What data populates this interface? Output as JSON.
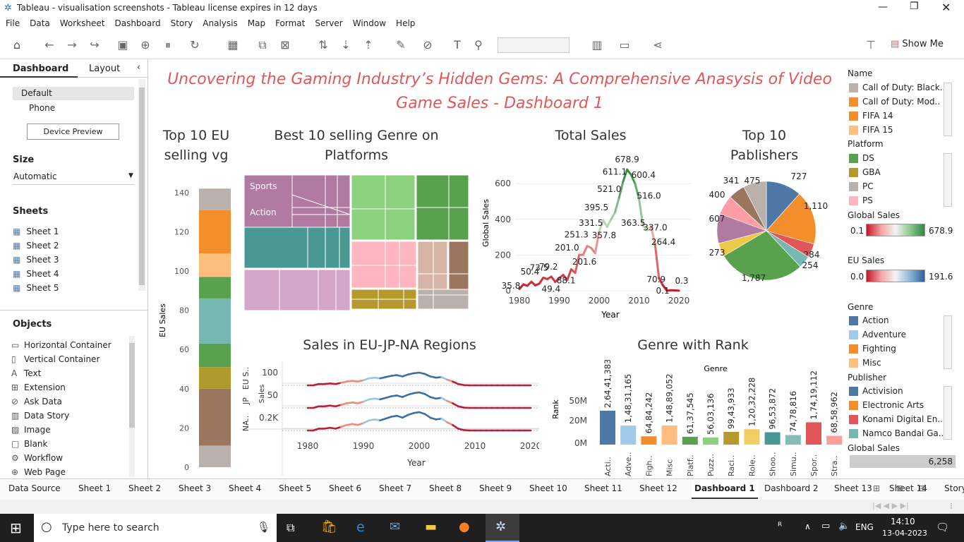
{
  "window": {
    "title": "Tableau - visualisation screenshots - Tableau license expires in 12 days"
  },
  "menu": [
    "File",
    "Data",
    "Worksheet",
    "Dashboard",
    "Story",
    "Analysis",
    "Map",
    "Format",
    "Server",
    "Window",
    "Help"
  ],
  "toolbar": {
    "show_me": "Show Me"
  },
  "left": {
    "tab_dashboard": "Dashboard",
    "tab_layout": "Layout",
    "devices": [
      "Default",
      "Phone"
    ],
    "device_preview": "Device Preview",
    "size_h": "Size",
    "size_val": "Automatic",
    "sheets_h": "Sheets",
    "sheets": [
      "Sheet 1",
      "Sheet 2",
      "Sheet 3",
      "Sheet 4",
      "Sheet 5"
    ],
    "objects_h": "Objects",
    "objects": [
      "Horizontal Container",
      "Vertical Container",
      "Text",
      "Extension",
      "Ask Data",
      "Data Story",
      "Image",
      "Blank",
      "Workflow",
      "Web Page"
    ]
  },
  "dashboard": {
    "title": "Uncovering the Gaming Industry’s Hidden Gems: A Comprehensive Anasysis of Video Game Sales - Dashboard  1",
    "eu_title": "Top 10 EU selling vg",
    "eu_ylabel": "EU Sales",
    "eu_ticks": [
      "140",
      "120",
      "100",
      "80",
      "60",
      "40",
      "20",
      "0"
    ],
    "tm_title": "Best 10 selling Genre on Platforms",
    "tm_labels": [
      "Sports",
      "Action"
    ],
    "ts_title": "Total Sales",
    "ts_ylabel": "Global Sales",
    "ts_xlabel": "Year",
    "pie_title": "Top 10 Pablishers",
    "reg_title": "Sales in EU-JP-NA Regions",
    "reg_xlabel": "Year",
    "reg_sales": "Sales",
    "reg_rows": [
      "EU S..",
      "JP",
      "NA.."
    ],
    "reg_ticks": [
      "100",
      "50",
      "0.2K"
    ],
    "rank_title": "Genre with Rank",
    "rank_header": "Genre",
    "rank_ylabel": "Rank"
  },
  "chart_data": [
    {
      "type": "bar",
      "title": "Top 10 EU selling vg",
      "ylabel": "EU Sales",
      "ylim": [
        0,
        145
      ],
      "stacked": true,
      "colors": [
        "#bab0ac",
        "#9c755f",
        "#b09a2c",
        "#59a14f",
        "#76b7b2",
        "#59a14f",
        "#ffbe7d",
        "#f28e2b",
        "#bab0ac"
      ],
      "values": [
        11,
        29,
        11,
        12,
        23,
        11,
        12,
        22,
        11
      ]
    },
    {
      "type": "line",
      "title": "Total Sales",
      "xlabel": "Year",
      "ylabel": "Global Sales",
      "ylim": [
        0,
        700
      ],
      "x": [
        1980,
        1983,
        1985,
        1987,
        1989,
        1991,
        1993,
        1995,
        1997,
        2000,
        2002,
        2004,
        2006,
        2008,
        2009,
        2011,
        2013,
        2015,
        2017,
        2020
      ],
      "y": [
        35.8,
        50.4,
        73.5,
        79.2,
        49.4,
        88.1,
        201.0,
        251.3,
        201.6,
        331.5,
        395.5,
        357.8,
        521.0,
        611.1,
        678.9,
        600.4,
        516.0,
        363.5,
        337.0,
        0.3
      ],
      "labels": [
        "35.8",
        "50.4",
        "73.5",
        "79.2",
        "49.4",
        "88.1",
        "201.0",
        "251.3",
        "201.6",
        "331.5",
        "395.5",
        "357.8",
        "521.0",
        "611.1",
        "678.9",
        "600.4",
        "516.0",
        "363.5",
        "337.0",
        "264.4",
        "70.9",
        "0.1",
        "0.3"
      ],
      "xticks": [
        "1980",
        "1990",
        "2000",
        "2010",
        "2020"
      ],
      "yticks": [
        "600",
        "400",
        "200",
        "0"
      ]
    },
    {
      "type": "pie",
      "title": "Top 10 Pablishers",
      "values": [
        727,
        1110,
        284,
        254,
        1787,
        273,
        607,
        400,
        341,
        475
      ],
      "labels": [
        "727",
        "1,110",
        "284",
        "254",
        "1,787",
        "273",
        "607",
        "400",
        "341",
        "475"
      ],
      "colors": [
        "#4e79a7",
        "#f28e2b",
        "#e15759",
        "#76b7b2",
        "#59a14f",
        "#edc948",
        "#b07aa1",
        "#ff9da7",
        "#9c755f",
        "#bab0ac"
      ]
    },
    {
      "type": "bar",
      "title": "Genre with Rank",
      "ylabel": "Rank",
      "categories": [
        "Acti..",
        "Adve..",
        "Figh..",
        "Misc",
        "Platf..",
        "Puzz..",
        "Raci..",
        "Role..",
        "Shoo..",
        "Simu..",
        "Spor..",
        "Stra.."
      ],
      "labels": [
        "2,64,41,383",
        "1,48,31,165",
        "64,84,242",
        "1,48,89,052",
        "61,37,545",
        "56,03,136",
        "99,43,933",
        "1,20,32,228",
        "96,53,872",
        "74,78,816",
        "1,74,19,112",
        "68,58,962"
      ],
      "values": [
        26441383,
        14831165,
        6484242,
        14889052,
        6137545,
        5603136,
        9943933,
        12032228,
        9653872,
        7478816,
        17419112,
        6858962
      ],
      "colors": [
        "#4e79a7",
        "#a0cbe8",
        "#f28e2b",
        "#ffbe7d",
        "#59a14f",
        "#8cd17d",
        "#b6992d",
        "#f1ce63",
        "#499894",
        "#86bcb6",
        "#e15759",
        "#ff9d9a"
      ],
      "yticks": [
        "50M",
        "20M",
        "0M"
      ]
    },
    {
      "type": "line",
      "title": "Sales in EU-JP-NA Regions",
      "xlabel": "Year",
      "xticks": [
        "1980",
        "1990",
        "2000",
        "2010",
        "2020"
      ]
    }
  ],
  "right": {
    "name_h": "Name",
    "names": [
      "Call of Duty: Black..",
      "Call of Duty: Mod..",
      "FIFA 14",
      "FIFA 15"
    ],
    "name_colors": [
      "#bab0ac",
      "#f28e2b",
      "#f28e2b",
      "#ffbe7d"
    ],
    "platform_h": "Platform",
    "platforms": [
      "DS",
      "GBA",
      "PC",
      "PS"
    ],
    "platform_colors": [
      "#59a14f",
      "#b6992d",
      "#bab0ac",
      "#ffb6c1"
    ],
    "gs_h": "Global Sales",
    "gs_min": "0.1",
    "gs_max": "678.9",
    "eu_h": "EU Sales",
    "eu_min": "0.0",
    "eu_max": "191.6",
    "genre_h": "Genre",
    "genres": [
      "Action",
      "Adventure",
      "Fighting",
      "Misc"
    ],
    "genre_colors": [
      "#4e79a7",
      "#a0cbe8",
      "#f28e2b",
      "#ffbe7d"
    ],
    "pub_h": "Publisher",
    "pubs": [
      "Activision",
      "Electronic Arts",
      "Konami Digital En..",
      "Namco Bandai Ga.."
    ],
    "pub_colors": [
      "#4e79a7",
      "#f28e2b",
      "#e15759",
      "#76b7b2"
    ],
    "gs2_h": "Global Sales",
    "gs2_val": "6,258"
  },
  "tabs": [
    "Data Source",
    "Sheet 1",
    "Sheet 2",
    "Sheet 3",
    "Sheet 4",
    "Sheet 5",
    "Sheet 6",
    "Sheet 7",
    "Sheet 8",
    "Sheet 9",
    "Sheet 10",
    "Sheet 11",
    "Sheet 12",
    "Dashboard 1",
    "Dashboard 2",
    "Sheet 13",
    "Sheet 14",
    "Story 1"
  ],
  "taskbar": {
    "search": "Type here to search",
    "lang": "ENG",
    "time": "14:10",
    "date": "13-04-2023"
  }
}
